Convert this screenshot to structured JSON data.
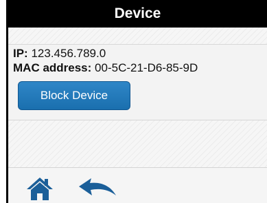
{
  "header": {
    "title": "Device"
  },
  "device": {
    "ip_label": "IP:",
    "ip_value": "123.456.789.0",
    "mac_label": "MAC address:",
    "mac_value": "00-5C-21-D6-85-9D"
  },
  "actions": {
    "block_label": "Block Device"
  },
  "footer": {
    "icons": [
      "home-icon",
      "back-arrow-icon"
    ]
  },
  "colors": {
    "header_bg": "#000000",
    "button_bg": "#1f76b6",
    "icon": "#1b5f99"
  }
}
